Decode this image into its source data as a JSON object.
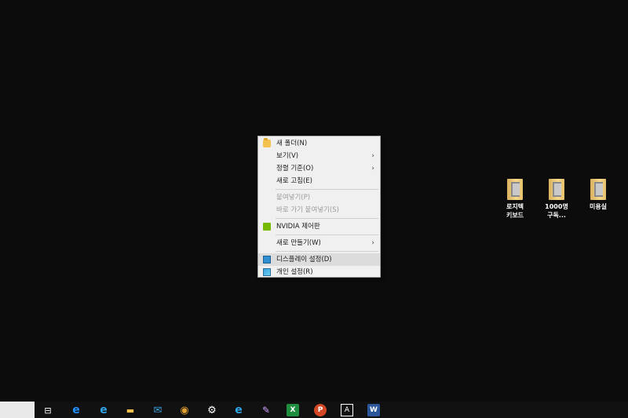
{
  "context_menu": {
    "items": [
      {
        "label": "새 폴더(N)",
        "icon": "folder-icon",
        "disabled": false
      },
      {
        "label": "보기(V)",
        "submenu": true,
        "disabled": false
      },
      {
        "label": "정렬 기준(O)",
        "submenu": true,
        "disabled": false
      },
      {
        "label": "새로 고침(E)",
        "disabled": false
      },
      {
        "label": "붙여넣기(P)",
        "disabled": true
      },
      {
        "label": "바로 가기 붙여넣기(S)",
        "disabled": true
      },
      {
        "label": "NVIDIA 제어판",
        "icon": "nvidia-icon",
        "disabled": false
      },
      {
        "label": "새로 만들기(W)",
        "submenu": true,
        "disabled": false
      },
      {
        "label": "디스플레이 설정(D)",
        "icon": "display-settings-icon",
        "disabled": false,
        "hovered": true
      },
      {
        "label": "개인 설정(R)",
        "icon": "personalize-icon",
        "disabled": false
      }
    ],
    "arrow_glyph": "›"
  },
  "desktop_icons": [
    {
      "line1": "로지텍",
      "line2": "키보드"
    },
    {
      "line1": "1000명",
      "line2": "구독..."
    },
    {
      "line1": "미용실",
      "line2": ""
    }
  ],
  "taskbar": {
    "task_view_glyph": "⊟",
    "icons": [
      {
        "name": "edge-icon",
        "glyph": "e",
        "color": "#1e90ff"
      },
      {
        "name": "internet-explorer-icon",
        "glyph": "e",
        "color": "#2fa6e8"
      },
      {
        "name": "file-explorer-icon",
        "glyph": "▬",
        "color": "#f2c14e"
      },
      {
        "name": "mail-icon",
        "glyph": "✉",
        "color": "#3aa0e0"
      },
      {
        "name": "chrome-icon",
        "glyph": "◉",
        "color": "#e0a030"
      },
      {
        "name": "settings-gear-icon",
        "glyph": "⚙",
        "color": "#ffffff"
      },
      {
        "name": "internet-explorer-2-icon",
        "glyph": "e",
        "color": "#2fa6e8"
      },
      {
        "name": "paint-icon",
        "glyph": "✎",
        "color": "#d0a0ff"
      },
      {
        "name": "excel-icon",
        "glyph": "X",
        "color": "#1e8e3e"
      },
      {
        "name": "powerpoint-icon",
        "glyph": "P",
        "color": "#d24726"
      },
      {
        "name": "font-app-icon",
        "glyph": "A",
        "color": "#ffffff"
      },
      {
        "name": "word-icon",
        "glyph": "W",
        "color": "#2b579a"
      }
    ]
  }
}
